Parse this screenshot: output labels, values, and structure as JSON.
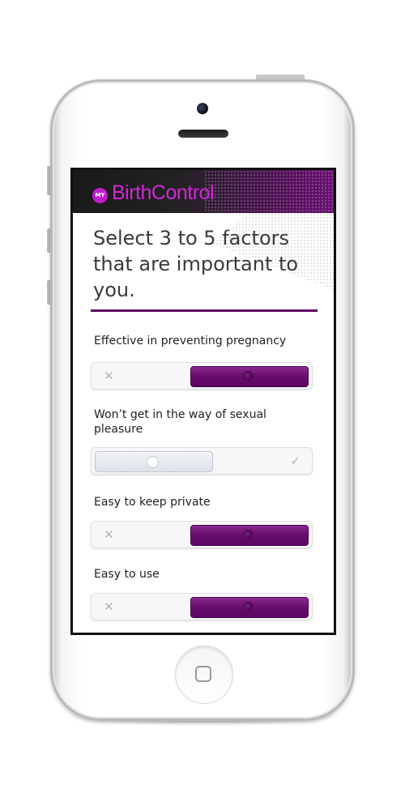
{
  "app": {
    "logo_badge": "MY",
    "logo_text": "BirthControl",
    "accent_color": "#6a0c70",
    "brand_color": "#d028d8"
  },
  "title": "Select 3 to 5 factors that are important to you.",
  "factors": [
    {
      "label": "Effective in preventing pregnancy",
      "state": "on",
      "off_icon": "x-icon"
    },
    {
      "label": "Won’t get in the way of sexual pleasure",
      "state": "off",
      "on_icon": "check-icon"
    },
    {
      "label": "Easy to keep private",
      "state": "on",
      "off_icon": "x-icon"
    },
    {
      "label": "Easy to use",
      "state": "on",
      "off_icon": "x-icon"
    }
  ],
  "icons": {
    "x": "✕",
    "check": "✓"
  }
}
